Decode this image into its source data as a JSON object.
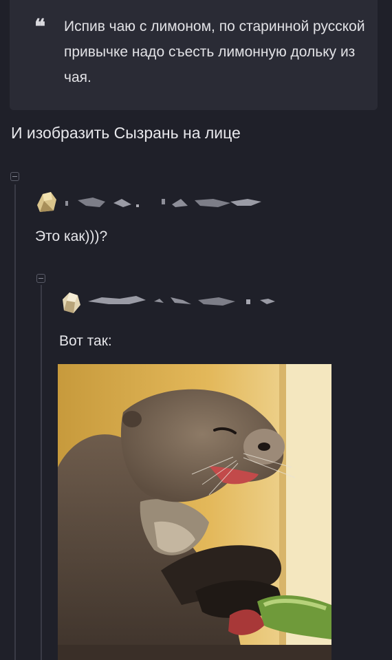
{
  "quote": {
    "icon": "quote-icon",
    "text": "Испив чаю с лимоном, по старинной русской привычке надо съесть лимонную дольку из чая."
  },
  "post": {
    "text": "И изобразить Сызрань на лице"
  },
  "comments": [
    {
      "author_hidden": true,
      "text": "Это как)))?"
    },
    {
      "author_hidden": true,
      "text": "Вот так:"
    }
  ],
  "image": {
    "subject": "otter-photo"
  },
  "colors": {
    "background": "#1f2029",
    "quote_bg": "#2a2b35",
    "thread_line": "#3a3b46"
  }
}
